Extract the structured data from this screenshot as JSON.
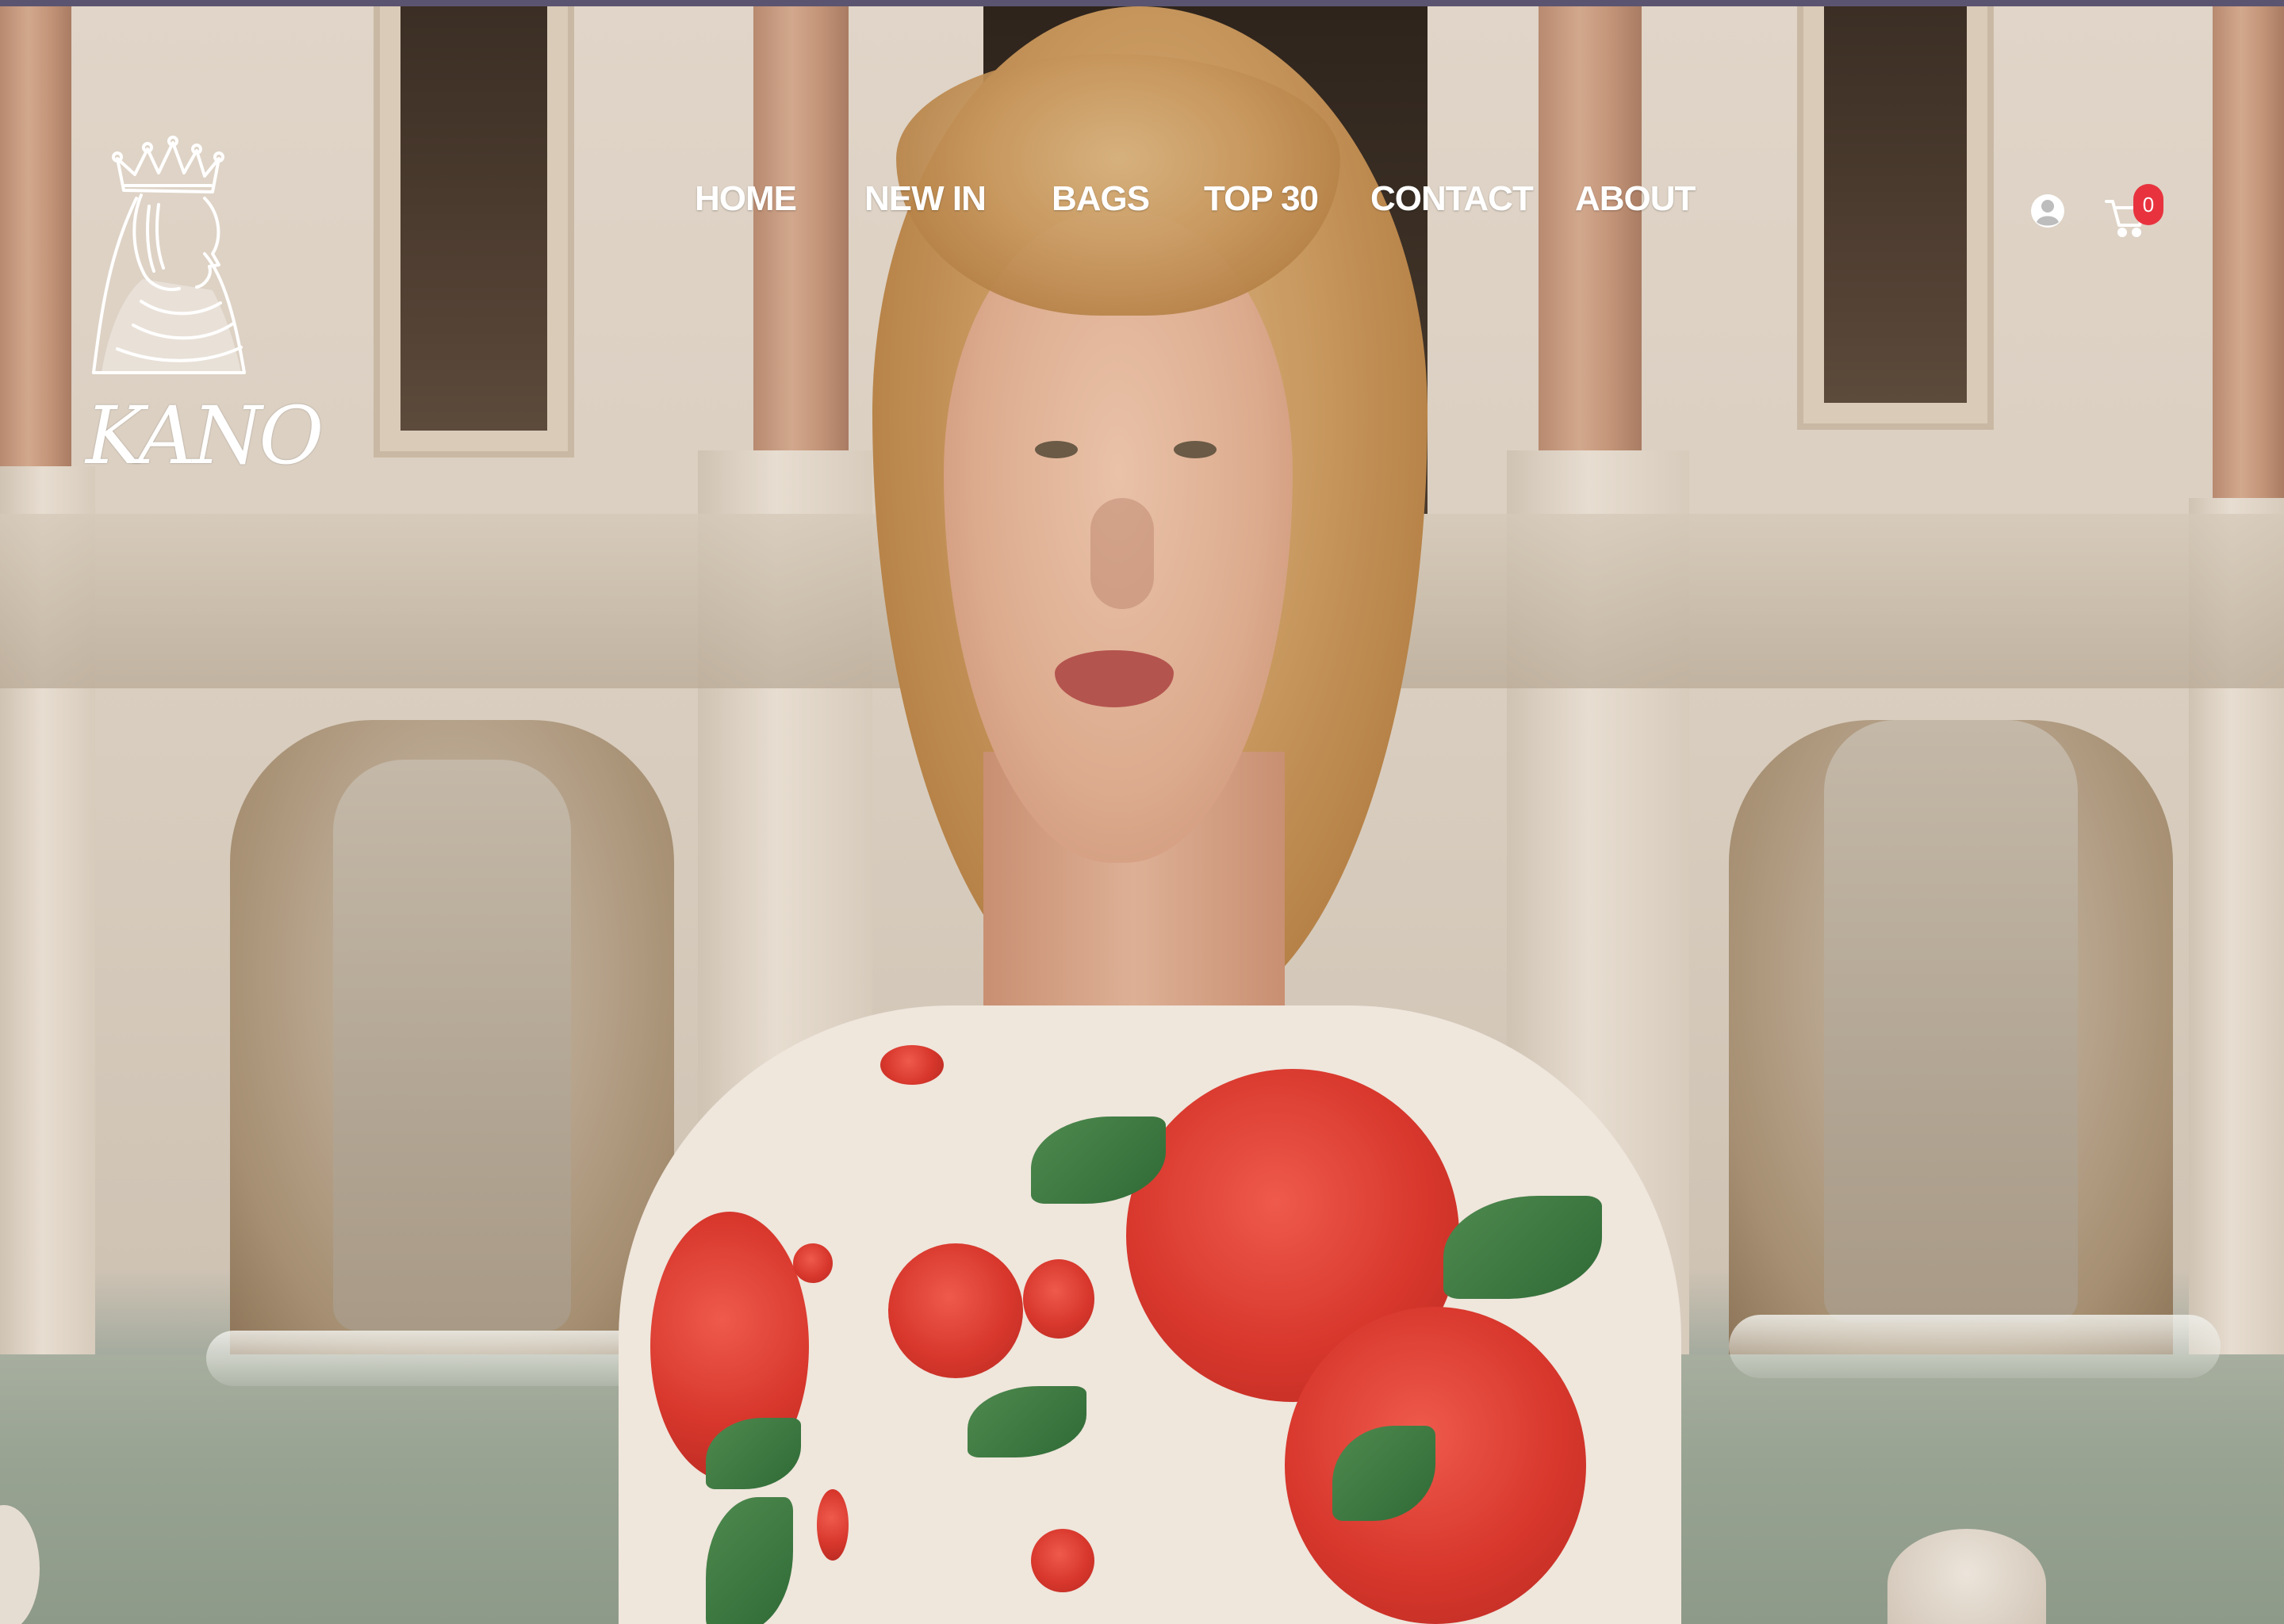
{
  "brand": {
    "logo_text": "KANO",
    "logo_icon": "crowned-queen-icon"
  },
  "nav": {
    "items": [
      {
        "label": "HOME"
      },
      {
        "label": "NEW IN"
      },
      {
        "label": "BAGS"
      },
      {
        "label": "TOP 30"
      },
      {
        "label": "CONTACT"
      },
      {
        "label": "ABOUT"
      }
    ]
  },
  "header_actions": {
    "account_icon": "user-icon",
    "cart_icon": "shopping-cart-icon",
    "cart_count": "0",
    "badge_color": "#e8333f"
  },
  "hero": {
    "image": "hero-photo"
  },
  "colors": {
    "nav_text": "#ffffff",
    "top_strip": "#5b5470"
  }
}
